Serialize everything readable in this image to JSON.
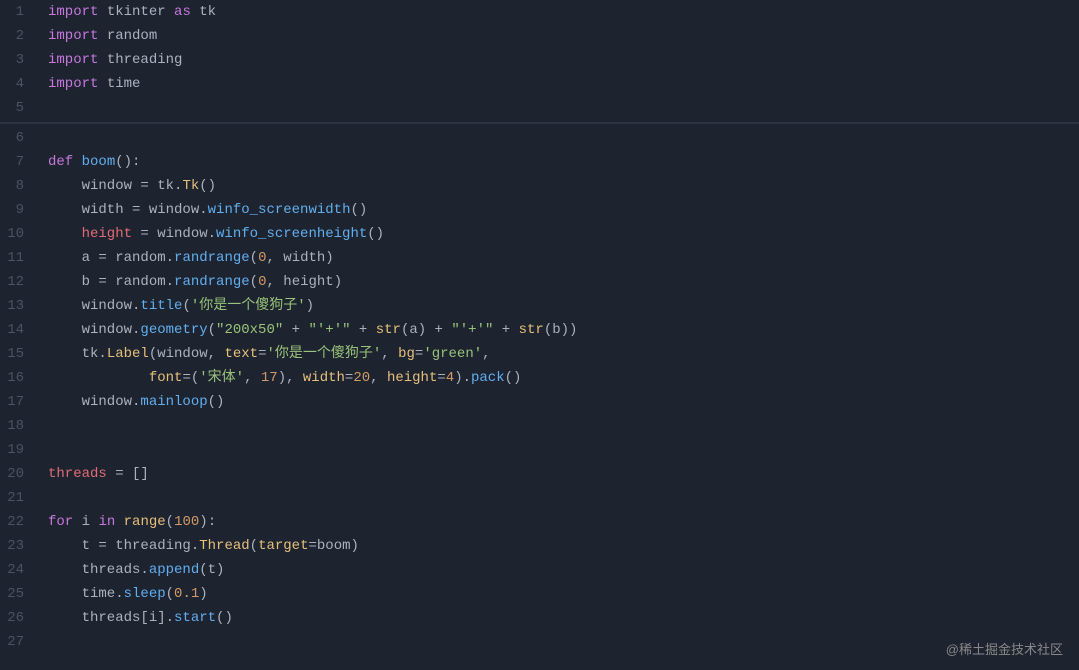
{
  "watermark": "@稀土掘金技术社区",
  "lines": [
    {
      "num": 1,
      "tokens": [
        {
          "t": "kw",
          "v": "import"
        },
        {
          "t": "plain",
          "v": " tkinter "
        },
        {
          "t": "kw",
          "v": "as"
        },
        {
          "t": "plain",
          "v": " tk"
        }
      ]
    },
    {
      "num": 2,
      "tokens": [
        {
          "t": "kw",
          "v": "import"
        },
        {
          "t": "plain",
          "v": " random"
        }
      ]
    },
    {
      "num": 3,
      "tokens": [
        {
          "t": "kw",
          "v": "import"
        },
        {
          "t": "plain",
          "v": " threading"
        }
      ]
    },
    {
      "num": 4,
      "tokens": [
        {
          "t": "kw",
          "v": "import"
        },
        {
          "t": "plain",
          "v": " time"
        }
      ]
    },
    {
      "num": 5,
      "tokens": []
    },
    {
      "num": 6,
      "tokens": [],
      "separator": true
    },
    {
      "num": 7,
      "tokens": [
        {
          "t": "kw",
          "v": "def"
        },
        {
          "t": "plain",
          "v": " "
        },
        {
          "t": "fn",
          "v": "boom"
        },
        {
          "t": "plain",
          "v": "():"
        }
      ]
    },
    {
      "num": 8,
      "tokens": [
        {
          "t": "plain",
          "v": "    window "
        },
        {
          "t": "plain",
          "v": "= "
        },
        {
          "t": "plain",
          "v": "tk."
        },
        {
          "t": "builtin",
          "v": "Tk"
        },
        {
          "t": "plain",
          "v": "()"
        }
      ]
    },
    {
      "num": 9,
      "tokens": [
        {
          "t": "plain",
          "v": "    width "
        },
        {
          "t": "plain",
          "v": "= window."
        },
        {
          "t": "method",
          "v": "winfo_screenwidth"
        },
        {
          "t": "plain",
          "v": "()"
        }
      ]
    },
    {
      "num": 10,
      "tokens": [
        {
          "t": "var",
          "v": "    height"
        },
        {
          "t": "plain",
          "v": " = window."
        },
        {
          "t": "method",
          "v": "winfo_screenheight"
        },
        {
          "t": "plain",
          "v": "()"
        }
      ]
    },
    {
      "num": 11,
      "tokens": [
        {
          "t": "plain",
          "v": "    a "
        },
        {
          "t": "plain",
          "v": "= random."
        },
        {
          "t": "method",
          "v": "randrange"
        },
        {
          "t": "plain",
          "v": "("
        },
        {
          "t": "num",
          "v": "0"
        },
        {
          "t": "plain",
          "v": ", width)"
        }
      ]
    },
    {
      "num": 12,
      "tokens": [
        {
          "t": "plain",
          "v": "    b "
        },
        {
          "t": "plain",
          "v": "= random."
        },
        {
          "t": "method",
          "v": "randrange"
        },
        {
          "t": "plain",
          "v": "("
        },
        {
          "t": "num",
          "v": "0"
        },
        {
          "t": "plain",
          "v": ", height)"
        }
      ]
    },
    {
      "num": 13,
      "tokens": [
        {
          "t": "plain",
          "v": "    window."
        },
        {
          "t": "method",
          "v": "title"
        },
        {
          "t": "plain",
          "v": "("
        },
        {
          "t": "str",
          "v": "'你是一个傻狗子'"
        },
        {
          "t": "plain",
          "v": ")"
        }
      ]
    },
    {
      "num": 14,
      "tokens": [
        {
          "t": "plain",
          "v": "    window."
        },
        {
          "t": "method",
          "v": "geometry"
        },
        {
          "t": "plain",
          "v": "("
        },
        {
          "t": "str",
          "v": "\"200x50\""
        },
        {
          "t": "plain",
          "v": " + "
        },
        {
          "t": "str",
          "v": "\"'+'\""
        },
        {
          "t": "plain",
          "v": " + "
        },
        {
          "t": "builtin",
          "v": "str"
        },
        {
          "t": "plain",
          "v": "(a) + "
        },
        {
          "t": "str",
          "v": "\"'+'\""
        },
        {
          "t": "plain",
          "v": " + "
        },
        {
          "t": "builtin",
          "v": "str"
        },
        {
          "t": "plain",
          "v": "(b))"
        }
      ]
    },
    {
      "num": 15,
      "tokens": [
        {
          "t": "plain",
          "v": "    tk."
        },
        {
          "t": "builtin",
          "v": "Label"
        },
        {
          "t": "plain",
          "v": "(window, "
        },
        {
          "t": "param",
          "v": "text"
        },
        {
          "t": "plain",
          "v": "="
        },
        {
          "t": "str",
          "v": "'你是一个傻狗子'"
        },
        {
          "t": "plain",
          "v": ", "
        },
        {
          "t": "param",
          "v": "bg"
        },
        {
          "t": "plain",
          "v": "="
        },
        {
          "t": "str",
          "v": "'green'"
        },
        {
          "t": "plain",
          "v": ","
        }
      ]
    },
    {
      "num": 16,
      "tokens": [
        {
          "t": "plain",
          "v": "            "
        },
        {
          "t": "param",
          "v": "font"
        },
        {
          "t": "plain",
          "v": "=("
        },
        {
          "t": "str",
          "v": "'宋体'"
        },
        {
          "t": "plain",
          "v": ", "
        },
        {
          "t": "num",
          "v": "17"
        },
        {
          "t": "plain",
          "v": "), "
        },
        {
          "t": "param",
          "v": "width"
        },
        {
          "t": "plain",
          "v": "="
        },
        {
          "t": "num",
          "v": "20"
        },
        {
          "t": "plain",
          "v": ", "
        },
        {
          "t": "param",
          "v": "height"
        },
        {
          "t": "plain",
          "v": "="
        },
        {
          "t": "num",
          "v": "4"
        },
        {
          "t": "plain",
          "v": ")."
        },
        {
          "t": "method",
          "v": "pack"
        },
        {
          "t": "plain",
          "v": "()"
        }
      ]
    },
    {
      "num": 17,
      "tokens": [
        {
          "t": "plain",
          "v": "    window."
        },
        {
          "t": "method",
          "v": "mainloop"
        },
        {
          "t": "plain",
          "v": "()"
        }
      ]
    },
    {
      "num": 18,
      "tokens": []
    },
    {
      "num": 19,
      "tokens": []
    },
    {
      "num": 20,
      "tokens": [
        {
          "t": "var",
          "v": "threads"
        },
        {
          "t": "plain",
          "v": " = []"
        }
      ]
    },
    {
      "num": 21,
      "tokens": []
    },
    {
      "num": 22,
      "tokens": [
        {
          "t": "kw",
          "v": "for"
        },
        {
          "t": "plain",
          "v": " i "
        },
        {
          "t": "kw",
          "v": "in"
        },
        {
          "t": "plain",
          "v": " "
        },
        {
          "t": "builtin",
          "v": "range"
        },
        {
          "t": "plain",
          "v": "("
        },
        {
          "t": "num",
          "v": "100"
        },
        {
          "t": "plain",
          "v": "):"
        }
      ]
    },
    {
      "num": 23,
      "tokens": [
        {
          "t": "plain",
          "v": "    t = threading."
        },
        {
          "t": "builtin",
          "v": "Thread"
        },
        {
          "t": "plain",
          "v": "("
        },
        {
          "t": "param",
          "v": "target"
        },
        {
          "t": "plain",
          "v": "=boom)"
        }
      ]
    },
    {
      "num": 24,
      "tokens": [
        {
          "t": "plain",
          "v": "    threads."
        },
        {
          "t": "method",
          "v": "append"
        },
        {
          "t": "plain",
          "v": "(t)"
        }
      ]
    },
    {
      "num": 25,
      "tokens": [
        {
          "t": "plain",
          "v": "    time."
        },
        {
          "t": "method",
          "v": "sleep"
        },
        {
          "t": "plain",
          "v": "("
        },
        {
          "t": "num",
          "v": "0.1"
        },
        {
          "t": "plain",
          "v": ")"
        }
      ]
    },
    {
      "num": 26,
      "tokens": [
        {
          "t": "plain",
          "v": "    threads[i]."
        },
        {
          "t": "method",
          "v": "start"
        },
        {
          "t": "plain",
          "v": "()"
        }
      ]
    },
    {
      "num": 27,
      "tokens": []
    }
  ]
}
